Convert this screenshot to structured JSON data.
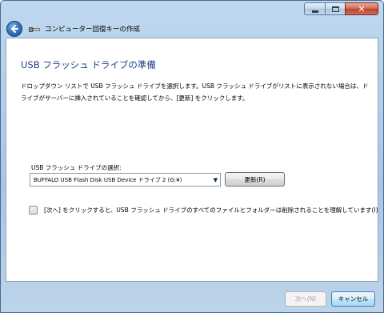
{
  "window": {
    "title": "コンピューター回復キーの作成",
    "controls": {
      "minimize": "minimize",
      "maximize": "maximize",
      "close": "close"
    }
  },
  "main": {
    "heading": "USB フラッシュ ドライブの準備",
    "description": "ドロップダウン リストで USB フラッシュ ドライブを選択します。USB フラッシュ ドライブがリストに表示されない場合は、ドライブがサーバーに挿入されていることを確認してから、[更新] をクリックします。",
    "select_label": "USB フラッシュ ドライブの選択:",
    "selected_drive": "BUFFALO USB Flash Disk USB Device ドライブ 2 (G:¥)",
    "refresh_button": "更新(R)",
    "checkbox_label": "[次へ] をクリックすると、USB フラッシュ ドライブのすべてのファイルとフォルダーは削除されることを理解しています(I)",
    "checkbox_checked": false
  },
  "footer": {
    "next_button": "次へ(N)",
    "cancel_button": "キャンセル"
  },
  "colors": {
    "heading": "#1e3f8a",
    "frame": "#a9c6e4",
    "close": "#c0402a"
  }
}
